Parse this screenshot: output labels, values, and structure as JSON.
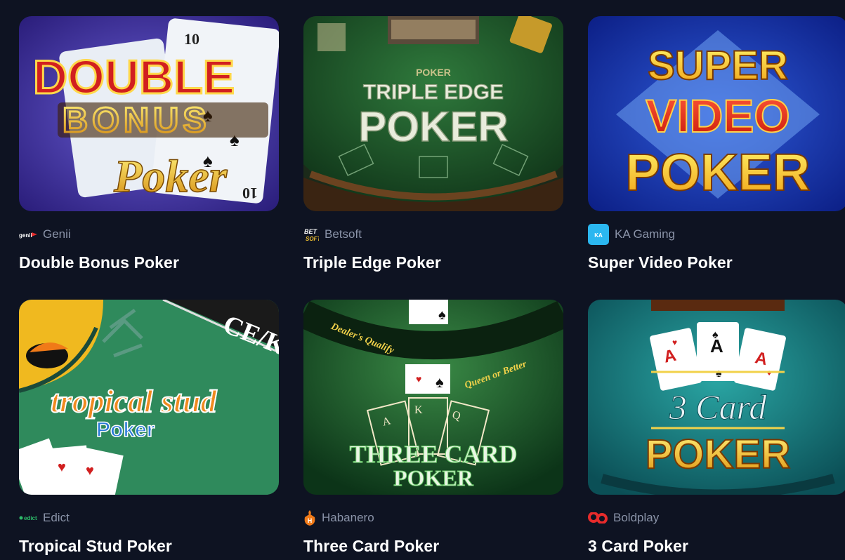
{
  "games": [
    {
      "title": "Double Bonus Poker",
      "provider": "Genii",
      "provider_icon": "genii-logo-icon",
      "thumbnail_icon": "double-bonus-poker-artwork",
      "art": {
        "line1": "DOUBLE",
        "line2": "BONUS",
        "line3": "Poker",
        "card_rank": "10"
      }
    },
    {
      "title": "Triple Edge Poker",
      "provider": "Betsoft",
      "provider_icon": "betsoft-logo-icon",
      "thumbnail_icon": "triple-edge-poker-artwork",
      "art": {
        "line0": "POKER",
        "line1": "TRIPLE EDGE",
        "line2": "POKER"
      }
    },
    {
      "title": "Super Video Poker",
      "provider": "KA Gaming",
      "provider_icon": "ka-gaming-logo-icon",
      "thumbnail_icon": "super-video-poker-artwork",
      "art": {
        "line1": "SUPER",
        "line2": "VIDEO",
        "line3": "POKER"
      }
    },
    {
      "title": "Tropical Stud Poker",
      "provider": "Edict",
      "provider_icon": "edict-logo-icon",
      "thumbnail_icon": "tropical-stud-poker-artwork",
      "art": {
        "line1": "tropical stud",
        "line2": "Poker",
        "corner": "CE/K"
      }
    },
    {
      "title": "Three Card Poker",
      "provider": "Habanero",
      "provider_icon": "habanero-logo-icon",
      "thumbnail_icon": "three-card-poker-artwork",
      "art": {
        "arc_left": "Dealer's Qualify",
        "arc_right": "Queen or Better",
        "line1": "THREE CARD",
        "line2": "POKER",
        "cards": [
          "A",
          "K",
          "Q"
        ]
      }
    },
    {
      "title": "3 Card Poker",
      "provider": "Boldplay",
      "provider_icon": "boldplay-logo-icon",
      "thumbnail_icon": "3-card-poker-artwork",
      "art": {
        "cards": [
          "A",
          "A",
          "A"
        ],
        "line1": "3 Card",
        "line2": "POKER"
      }
    }
  ],
  "colors": {
    "background": "#0e1322",
    "title": "#ffffff",
    "provider": "#8a93a8"
  }
}
